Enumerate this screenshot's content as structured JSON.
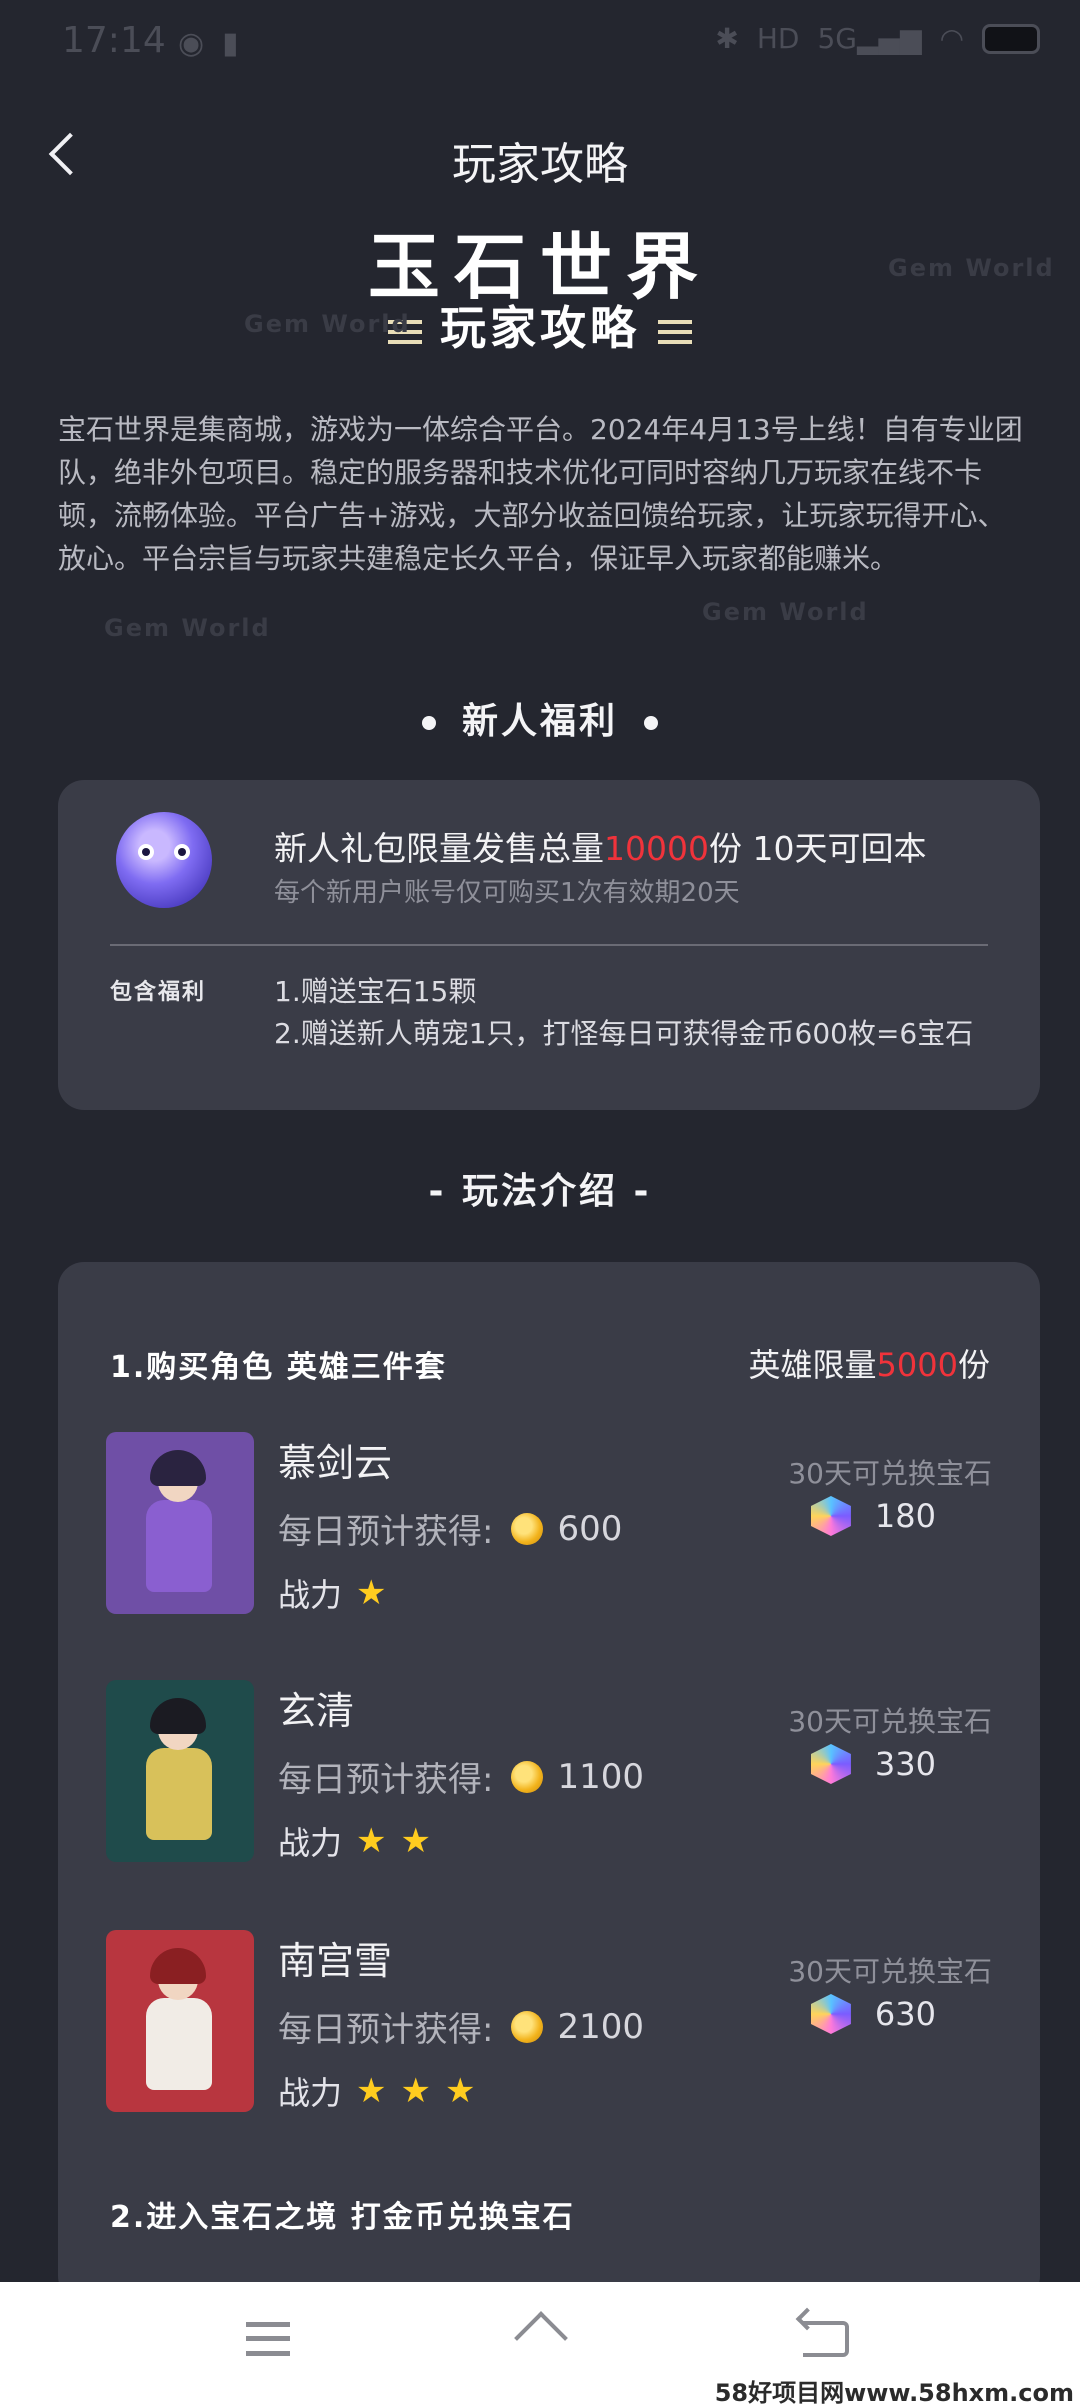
{
  "status_bar": {
    "time": "17:14",
    "left_icons": [
      "globe-icon",
      "clipboard-icon"
    ],
    "right_icons": [
      "bluetooth-icon",
      "hd-icon",
      "5g-signal-icon",
      "wifi-icon",
      "battery-icon"
    ],
    "hd_text": "HD",
    "network_text": "5G"
  },
  "header": {
    "title": "玩家攻略"
  },
  "hero": {
    "title": "玉石世界",
    "subtitle": "玩家攻略",
    "watermark": "Gem World"
  },
  "intro": "宝石世界是集商城，游戏为一体综合平台。2024年4月13号上线！自有专业团队，绝非外包项目。稳定的服务器和技术优化可同时容纳几万玩家在线不卡顿，流畅体验。平台广告+游戏，大部分收益回馈给玩家，让玩家玩得开心、放心。平台宗旨与玩家共建稳定长久平台，保证早入玩家都能赚米。",
  "newbie": {
    "section_title": "新人福利",
    "gift_prefix": "新人礼包限量发售总量",
    "gift_amount": "10000",
    "gift_suffix": "份 10天可回本",
    "gift_note": "每个新用户账号仅可购买1次有效期20天",
    "benefit_label": "包含福利",
    "benefits": [
      "1.赠送宝石15颗",
      "2.赠送新人萌宠1只，打怪每日可获得金币600枚=6宝石"
    ]
  },
  "gameplay": {
    "section_title": "- 玩法介绍 -",
    "step1_title": "1.购买角色 英雄三件套",
    "hero_limit_prefix": "英雄限量",
    "hero_limit_amount": "5000",
    "hero_limit_suffix": "份",
    "daily_label": "每日预计获得:",
    "power_label": "战力",
    "exchange_label": "30天可兑换宝石",
    "characters": [
      {
        "name": "慕剑云",
        "daily_coins": "600",
        "stars": 1,
        "gems": "180",
        "bg": "#6f4fa6",
        "hair": "#2a2340",
        "outfit": "#8a5fd0"
      },
      {
        "name": "玄清",
        "daily_coins": "1100",
        "stars": 2,
        "gems": "330",
        "bg": "#1f4b4b",
        "hair": "#1b1b22",
        "outfit": "#d8c15a"
      },
      {
        "name": "南宫雪",
        "daily_coins": "2100",
        "stars": 3,
        "gems": "630",
        "bg": "#b8363f",
        "hair": "#8a1f22",
        "outfit": "#f1ece6"
      }
    ],
    "step2_title": "2.进入宝石之境 打金币兑换宝石"
  },
  "bottom_nav": {
    "items": [
      "menu-icon",
      "home-icon",
      "back-return-icon"
    ],
    "site_mark": "58好项目网www.58hxm.com"
  }
}
